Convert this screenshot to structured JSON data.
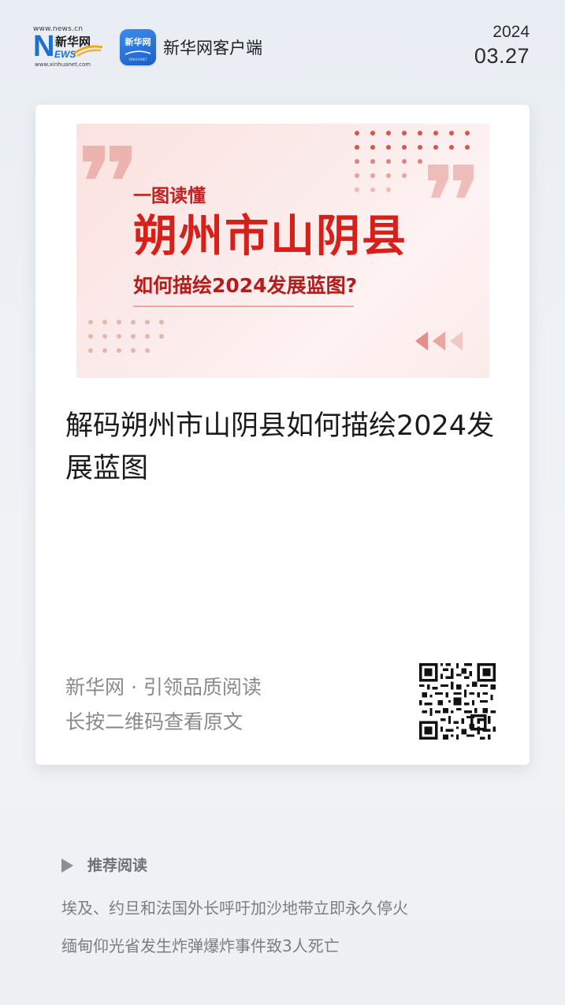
{
  "header": {
    "logo": {
      "url_top": "www.news.cn",
      "letter_n": "N",
      "cn_name": "新华网",
      "letters_ews": "EWS",
      "url_bottom": "www.xinhuanet.com"
    },
    "app_icon": {
      "text": "新华网",
      "subtext": "XINHUANET"
    },
    "app_name": "新华网客户端",
    "date": {
      "year": "2024",
      "month_day": "03.27"
    }
  },
  "card": {
    "cover": {
      "kicker": "一图读懂",
      "title": "朔州市山阴县",
      "subtitle": "如何描绘2024发展蓝图?"
    },
    "headline": "解码朔州市山阴县如何描绘2024发展蓝图",
    "footer": {
      "brand_line": "新华网 · 引领品质阅读",
      "qr_hint": "长按二维码查看原文"
    },
    "qr_icon": "qr-code"
  },
  "recommended": {
    "label": "推荐阅读",
    "items": [
      "埃及、约旦和法国外长呼吁加沙地带立即永久停火",
      "缅甸仰光省发生炸弹爆炸事件致3人死亡"
    ]
  },
  "colors": {
    "brand_blue": "#1f6fd1",
    "cover_red": "#d7201a",
    "muted_text": "#8a8a8a"
  }
}
